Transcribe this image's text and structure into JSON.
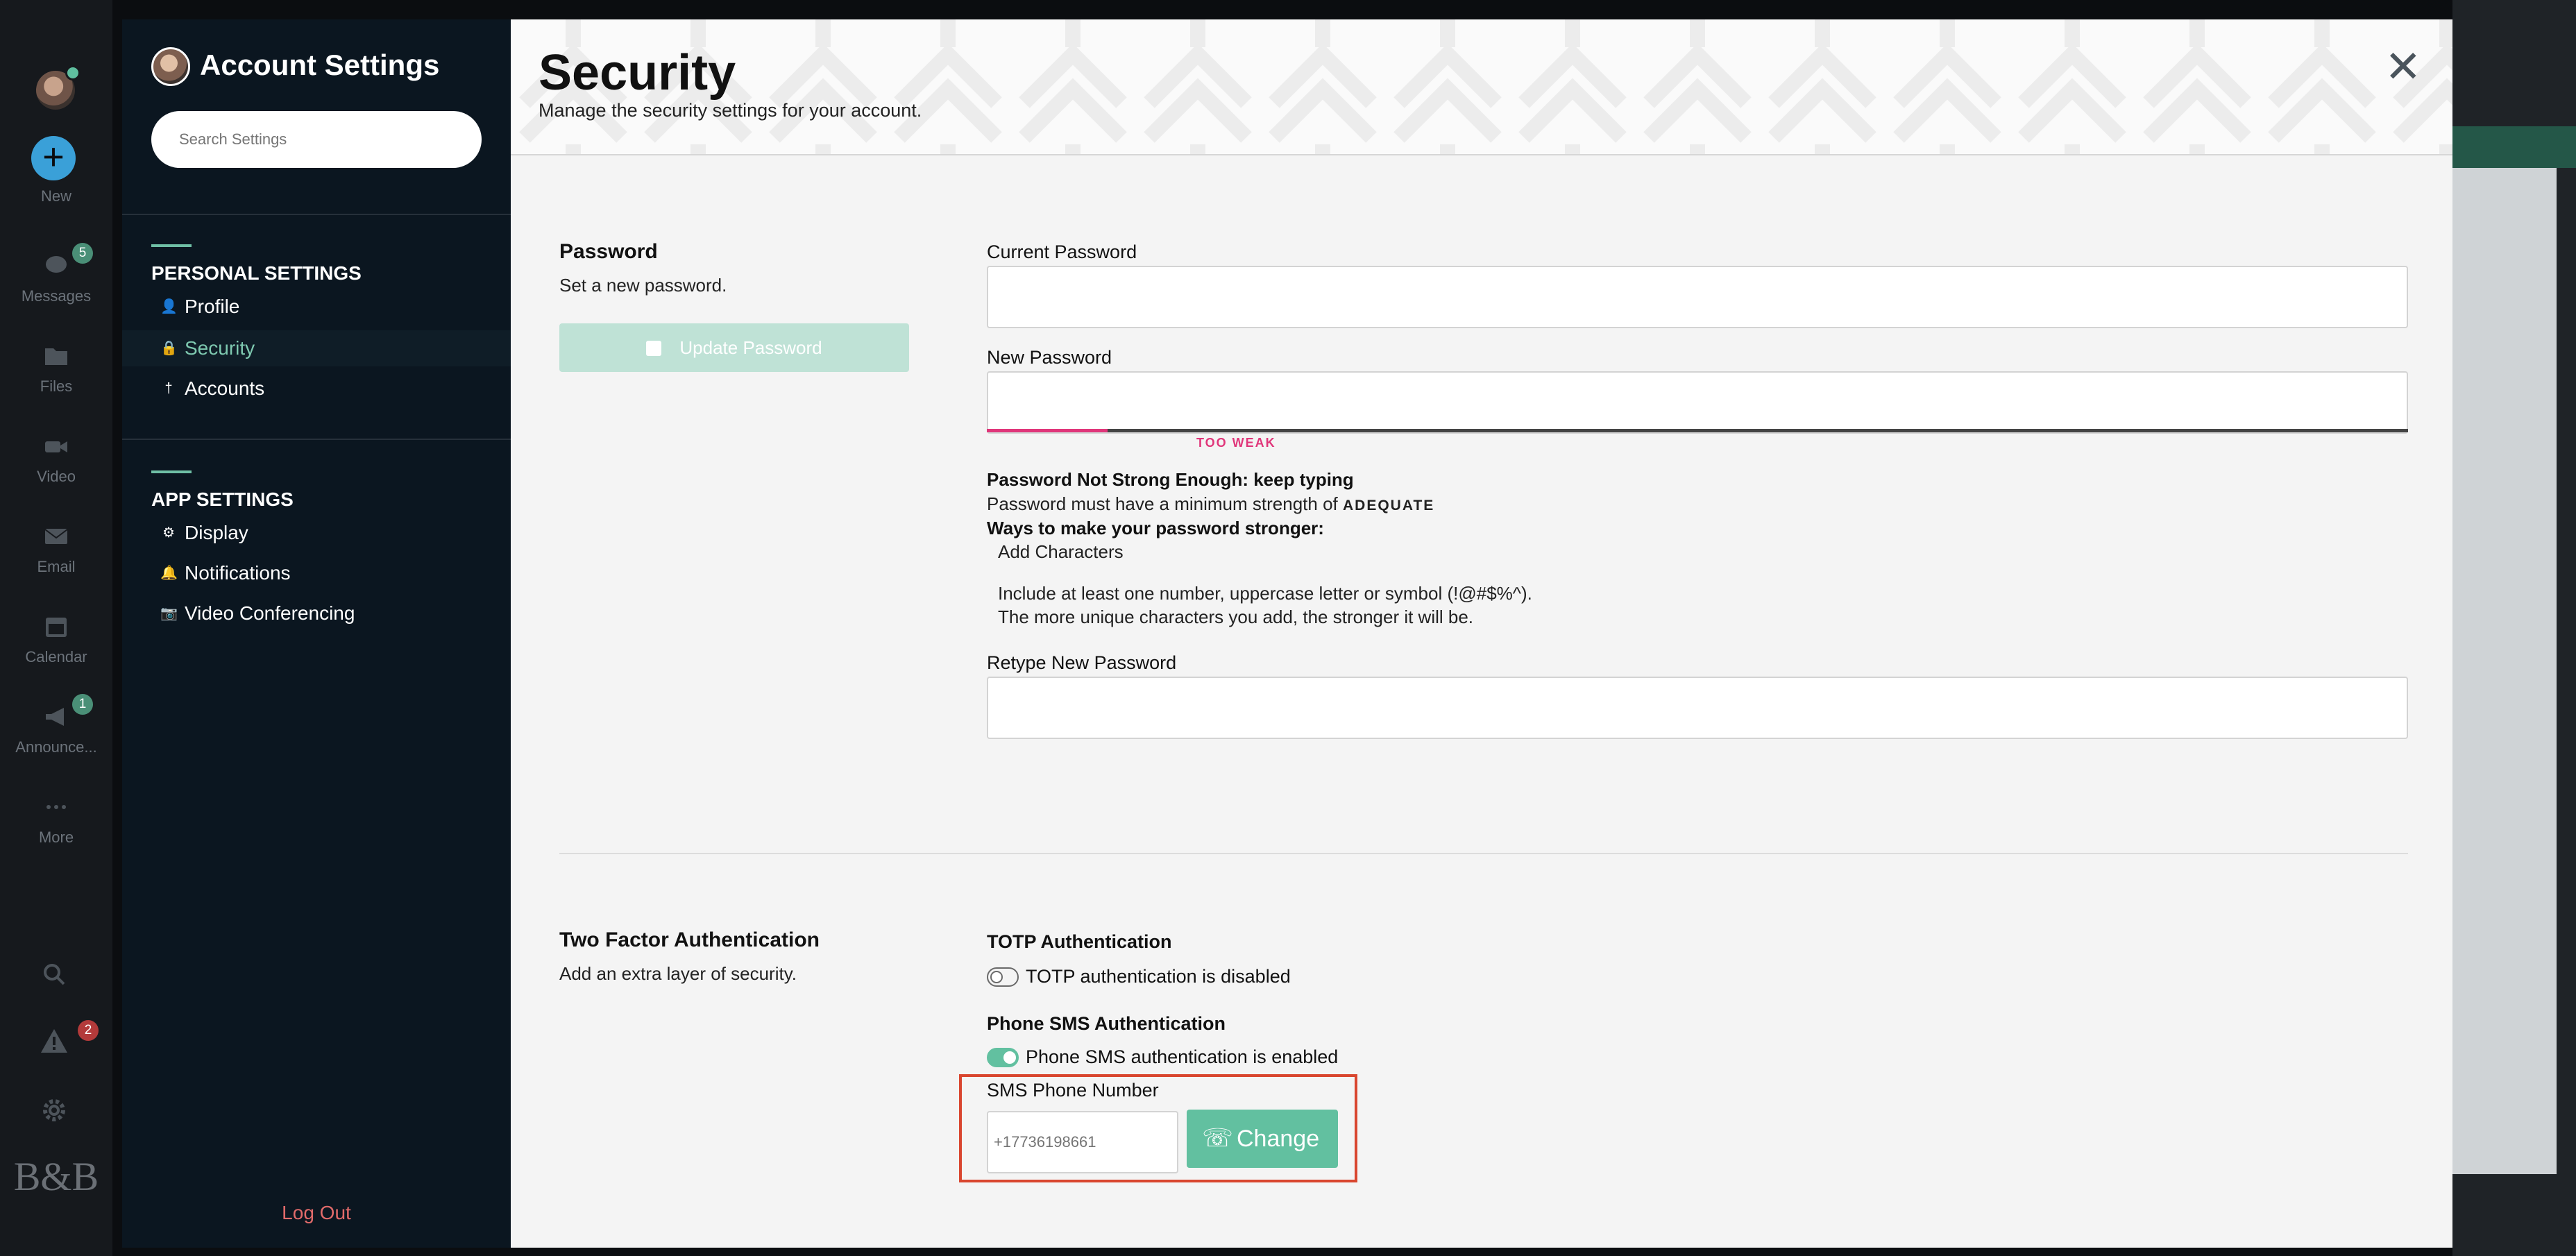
{
  "rail": {
    "new_label": "New",
    "items": [
      {
        "label": "Messages",
        "badge": "5"
      },
      {
        "label": "Files"
      },
      {
        "label": "Video"
      },
      {
        "label": "Email"
      },
      {
        "label": "Calendar"
      },
      {
        "label": "Announce...",
        "badge": "1"
      },
      {
        "label": "More"
      }
    ],
    "alerts_badge": "2",
    "logo": "B&B"
  },
  "settings_nav": {
    "title": "Account Settings",
    "search_placeholder": "Search Settings",
    "personal_heading": "PERSONAL SETTINGS",
    "personal_items": [
      {
        "label": "Profile",
        "icon": "person-icon"
      },
      {
        "label": "Security",
        "icon": "lock-icon",
        "active": true
      },
      {
        "label": "Accounts",
        "icon": "key-icon"
      }
    ],
    "app_heading": "APP SETTINGS",
    "app_items": [
      {
        "label": "Display",
        "icon": "gear-icon"
      },
      {
        "label": "Notifications",
        "icon": "bell-icon"
      },
      {
        "label": "Video Conferencing",
        "icon": "camera-icon"
      }
    ],
    "logout": "Log Out"
  },
  "header": {
    "title": "Security",
    "subtitle": "Manage the security settings for your account."
  },
  "password": {
    "heading": "Password",
    "description": "Set a new password.",
    "update_button": "Update Password",
    "current_label": "Current Password",
    "current_value": "",
    "new_label": "New Password",
    "new_value": "",
    "strength_label": "TOO WEAK",
    "strength_fraction": 0.085,
    "hint_title": "Password Not Strong Enough: keep typing",
    "hint_min_prefix": "Password must have a minimum strength of",
    "hint_min_value": "ADEQUATE",
    "hint_ways": "Ways to make your password stronger:",
    "hint_add": "Add Characters",
    "hint_include": "Include at least one number, uppercase letter or symbol (!@#$%^).",
    "hint_unique": "The more unique characters you add, the stronger it will be.",
    "retype_label": "Retype New Password",
    "retype_value": ""
  },
  "two_factor": {
    "heading": "Two Factor Authentication",
    "description": "Add an extra layer of security.",
    "totp_heading": "TOTP Authentication",
    "totp_status": "TOTP authentication is disabled",
    "totp_enabled": false,
    "sms_heading": "Phone SMS Authentication",
    "sms_status": "Phone SMS authentication is enabled",
    "sms_enabled": true,
    "phone_label": "SMS Phone Number",
    "phone_placeholder": "+17736198661",
    "change_button": "Change"
  },
  "colors": {
    "accent": "#62c0a0",
    "weak": "#e0367a",
    "highlight": "#d9462f"
  }
}
